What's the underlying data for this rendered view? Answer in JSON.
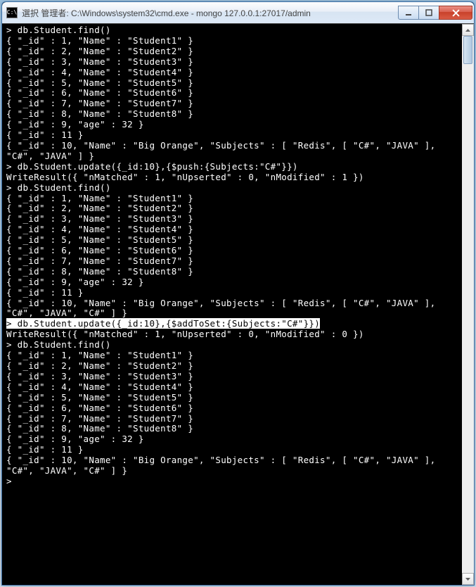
{
  "window": {
    "icon_text": "C:\\",
    "title": "選択 管理者: C:\\Windows\\system32\\cmd.exe - mongo  127.0.0.1:27017/admin"
  },
  "lines": [
    {
      "t": "> db.Student.find()"
    },
    {
      "t": "{ \"_id\" : 1, \"Name\" : \"Student1\" }"
    },
    {
      "t": "{ \"_id\" : 2, \"Name\" : \"Student2\" }"
    },
    {
      "t": "{ \"_id\" : 3, \"Name\" : \"Student3\" }"
    },
    {
      "t": "{ \"_id\" : 4, \"Name\" : \"Student4\" }"
    },
    {
      "t": "{ \"_id\" : 5, \"Name\" : \"Student5\" }"
    },
    {
      "t": "{ \"_id\" : 6, \"Name\" : \"Student6\" }"
    },
    {
      "t": "{ \"_id\" : 7, \"Name\" : \"Student7\" }"
    },
    {
      "t": "{ \"_id\" : 8, \"Name\" : \"Student8\" }"
    },
    {
      "t": "{ \"_id\" : 9, \"age\" : 32 }"
    },
    {
      "t": "{ \"_id\" : 11 }"
    },
    {
      "t": "{ \"_id\" : 10, \"Name\" : \"Big Orange\", \"Subjects\" : [ \"Redis\", [ \"C#\", \"JAVA\" ], \"C#\", \"JAVA\" ] }"
    },
    {
      "t": "> db.Student.update({_id:10},{$push:{Subjects:\"C#\"}})"
    },
    {
      "t": "WriteResult({ \"nMatched\" : 1, \"nUpserted\" : 0, \"nModified\" : 1 })"
    },
    {
      "t": "> db.Student.find()"
    },
    {
      "t": "{ \"_id\" : 1, \"Name\" : \"Student1\" }"
    },
    {
      "t": "{ \"_id\" : 2, \"Name\" : \"Student2\" }"
    },
    {
      "t": "{ \"_id\" : 3, \"Name\" : \"Student3\" }"
    },
    {
      "t": "{ \"_id\" : 4, \"Name\" : \"Student4\" }"
    },
    {
      "t": "{ \"_id\" : 5, \"Name\" : \"Student5\" }"
    },
    {
      "t": "{ \"_id\" : 6, \"Name\" : \"Student6\" }"
    },
    {
      "t": "{ \"_id\" : 7, \"Name\" : \"Student7\" }"
    },
    {
      "t": "{ \"_id\" : 8, \"Name\" : \"Student8\" }"
    },
    {
      "t": "{ \"_id\" : 9, \"age\" : 32 }"
    },
    {
      "t": "{ \"_id\" : 11 }"
    },
    {
      "t": "{ \"_id\" : 10, \"Name\" : \"Big Orange\", \"Subjects\" : [ \"Redis\", [ \"C#\", \"JAVA\" ], \"C#\", \"JAVA\", \"C#\" ] }"
    },
    {
      "t": "> db.Student.update({_id:10},{$addToSet:{Subjects:\"C#\"}})",
      "hl": true
    },
    {
      "t": "WriteResult({ \"nMatched\" : 1, \"nUpserted\" : 0, \"nModified\" : 0 })"
    },
    {
      "t": "> db.Student.find()"
    },
    {
      "t": "{ \"_id\" : 1, \"Name\" : \"Student1\" }"
    },
    {
      "t": "{ \"_id\" : 2, \"Name\" : \"Student2\" }"
    },
    {
      "t": "{ \"_id\" : 3, \"Name\" : \"Student3\" }"
    },
    {
      "t": "{ \"_id\" : 4, \"Name\" : \"Student4\" }"
    },
    {
      "t": "{ \"_id\" : 5, \"Name\" : \"Student5\" }"
    },
    {
      "t": "{ \"_id\" : 6, \"Name\" : \"Student6\" }"
    },
    {
      "t": "{ \"_id\" : 7, \"Name\" : \"Student7\" }"
    },
    {
      "t": "{ \"_id\" : 8, \"Name\" : \"Student8\" }"
    },
    {
      "t": "{ \"_id\" : 9, \"age\" : 32 }"
    },
    {
      "t": "{ \"_id\" : 11 }"
    },
    {
      "t": "{ \"_id\" : 10, \"Name\" : \"Big Orange\", \"Subjects\" : [ \"Redis\", [ \"C#\", \"JAVA\" ], \"C#\", \"JAVA\", \"C#\" ] }"
    },
    {
      "t": ">"
    }
  ]
}
